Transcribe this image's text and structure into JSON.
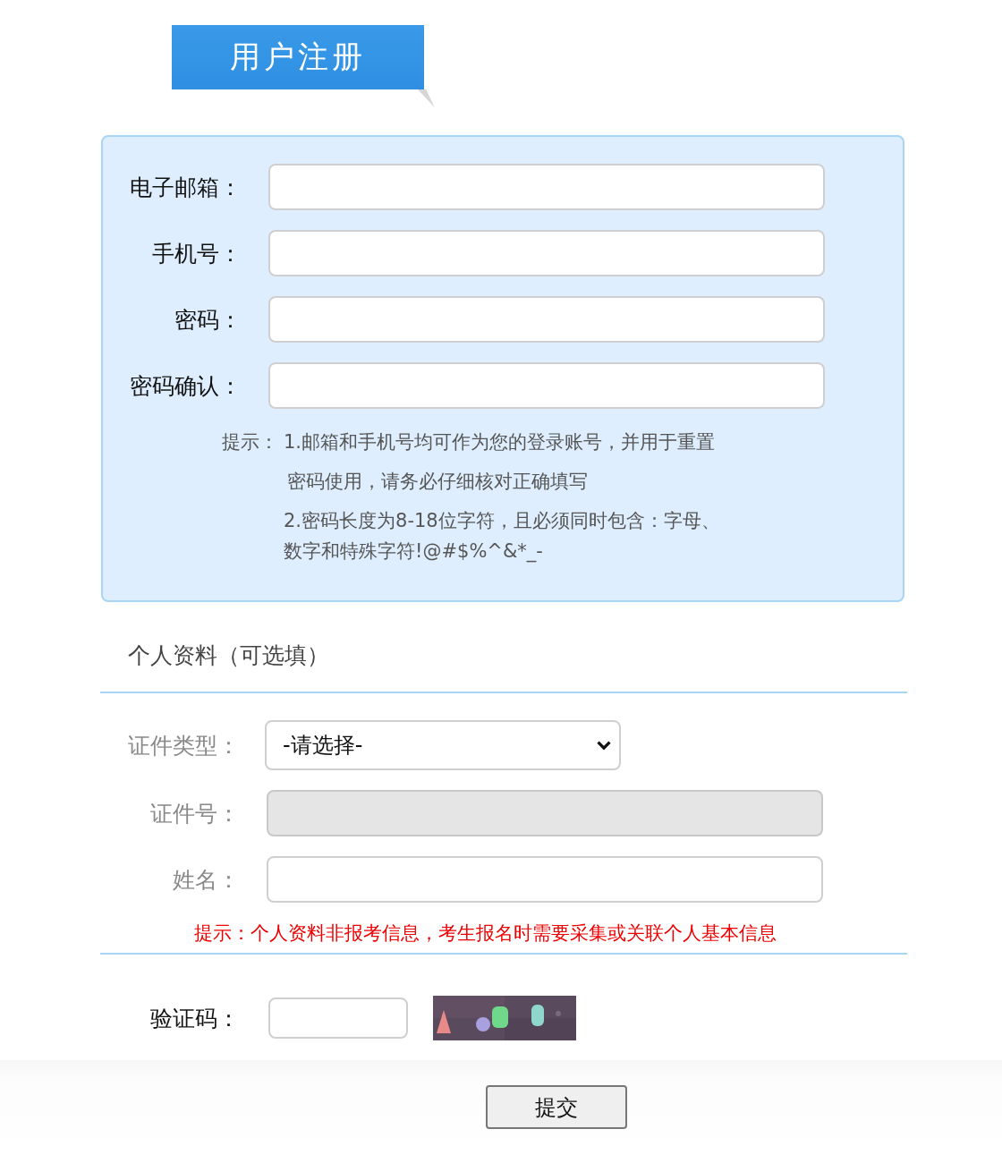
{
  "banner": {
    "title": "用户注册"
  },
  "account_fields": [
    {
      "label": "电子邮箱："
    },
    {
      "label": "手机号："
    },
    {
      "label": "密码："
    },
    {
      "label": "密码确认："
    }
  ],
  "account_hint": {
    "label": "提示：",
    "items": [
      {
        "lines": [
          "1.邮箱和手机号均可作为您的登录账号，并用于重置",
          "密码使用，请务必仔细核对正确填写"
        ]
      },
      {
        "lines": [
          "2.密码长度为8-18位字符，且必须同时包含：字母、",
          "数字和特殊字符!@#$%^&*_-"
        ]
      }
    ]
  },
  "profile": {
    "title": "个人资料（可选填）",
    "fields": [
      {
        "label": "证件类型：",
        "kind": "select",
        "value": "-请选择-",
        "disabled": false
      },
      {
        "label": "证件号：",
        "kind": "text",
        "disabled": true
      },
      {
        "label": "姓名：",
        "kind": "text",
        "disabled": false
      }
    ],
    "hint": "提示：个人资料非报考信息，考生报名时需要采集或关联个人基本信息"
  },
  "captcha": {
    "label": "验证码："
  },
  "submit_button": "提交"
}
